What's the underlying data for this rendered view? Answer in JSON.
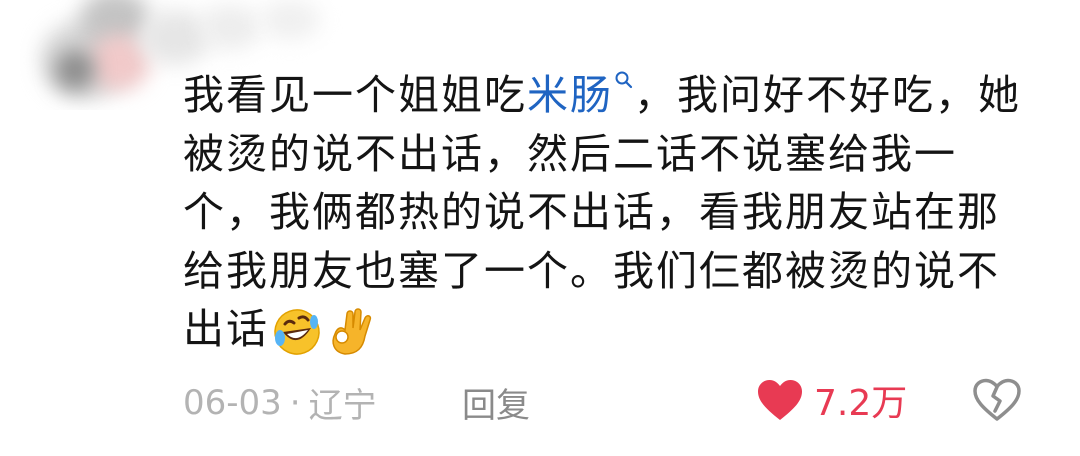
{
  "comment": {
    "text_before_keyword": "我看见一个姐姐吃",
    "keyword": "米肠",
    "keyword_icon": "search-icon",
    "text_after_keyword": "，我问好不好吃，她被烫的说不出话，然后二话不说塞给我一个，我俩都热的说不出话，看我朋友站在那给我朋友也塞了一个。我们仨都被烫的说不出话",
    "emojis": [
      "rofl-emoji",
      "ok-hand-emoji"
    ]
  },
  "meta": {
    "date": "06-03",
    "separator": "·",
    "location": "辽宁"
  },
  "actions": {
    "reply_label": "回复",
    "like_count": "7.2万",
    "like_icon": "heart-icon",
    "dislike_icon": "broken-heart-icon"
  },
  "colors": {
    "text": "#141414",
    "keyword": "#1f64c2",
    "meta": "#b3b3b3",
    "like": "#e83a53"
  }
}
